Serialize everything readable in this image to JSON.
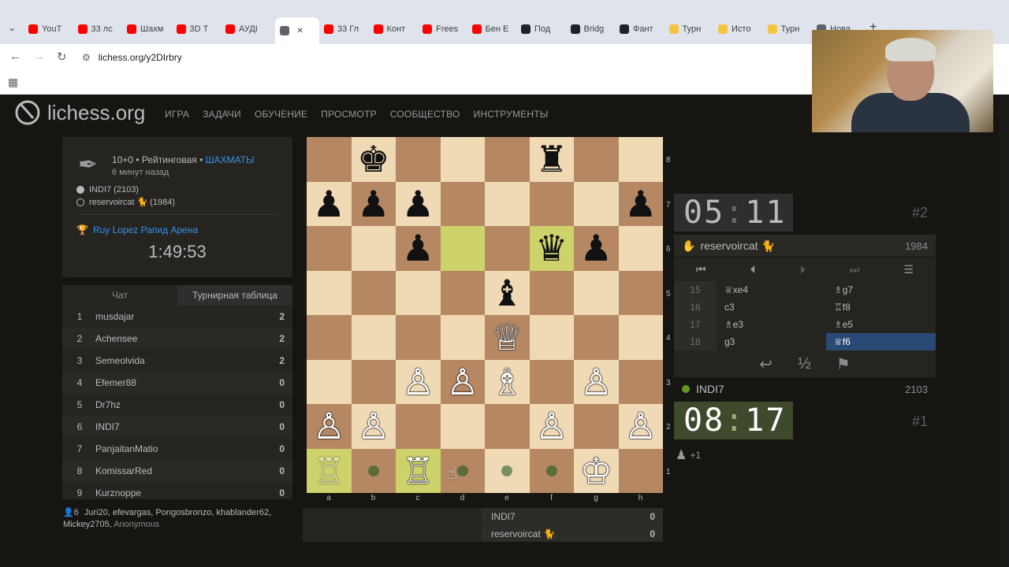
{
  "browser": {
    "tabs": [
      "YouT",
      "33 лс",
      "Шахм",
      "3D Т",
      "АУДІ",
      "",
      "33 Гл",
      "Конт",
      "Frees",
      "Бен Е",
      "Под",
      "Bridg",
      "Фант",
      "Турн",
      "Исто",
      "Турн",
      "Нова"
    ],
    "url": "lichess.org/y2DIrbry"
  },
  "site": {
    "logo": "lichess.org",
    "nav": [
      "ИГРА",
      "ЗАДАЧИ",
      "ОБУЧЕНИЕ",
      "ПРОСМОТР",
      "СООБЩЕСТВО",
      "ИНСТРУМЕНТЫ"
    ]
  },
  "game": {
    "mode": "10+0 • Рейтинговая •",
    "variant": "ШАХМАТЫ",
    "time_ago": "6 минут назад",
    "white_player": "INDI7 (2103)",
    "black_player": "reservoircat 🐈 (1984)",
    "tournament": "Ruy Lopez Рапид Арена",
    "tournament_clock": "1:49:53"
  },
  "standings": {
    "tabs": [
      "Чат",
      "Турнирная таблица"
    ],
    "rows": [
      {
        "rank": "1",
        "name": "musdajar",
        "score": "2"
      },
      {
        "rank": "2",
        "name": "Achensee",
        "score": "2"
      },
      {
        "rank": "3",
        "name": "Semeolvida",
        "score": "2"
      },
      {
        "rank": "4",
        "name": "Efemer88",
        "score": "0"
      },
      {
        "rank": "5",
        "name": "Dr7hz",
        "score": "0"
      },
      {
        "rank": "6",
        "name": "INDI7",
        "score": "0"
      },
      {
        "rank": "7",
        "name": "PanjaitanMatio",
        "score": "0"
      },
      {
        "rank": "8",
        "name": "KomissarRed",
        "score": "0"
      },
      {
        "rank": "9",
        "name": "Kurznoppe",
        "score": "0"
      }
    ]
  },
  "spectators": {
    "count": "6",
    "names": "Juri20, efevargas, Pongosbronzo, khablander62, Mickey2705,",
    "anon": "Anonymous"
  },
  "board": {
    "files": [
      "a",
      "b",
      "c",
      "d",
      "e",
      "f",
      "g",
      "h"
    ],
    "ranks": [
      "8",
      "7",
      "6",
      "5",
      "4",
      "3",
      "2",
      "1"
    ],
    "pieces": [
      {
        "sq": "b8",
        "glyph": "♚",
        "side": "b"
      },
      {
        "sq": "f8",
        "glyph": "♜",
        "side": "b"
      },
      {
        "sq": "a7",
        "glyph": "♟",
        "side": "b"
      },
      {
        "sq": "b7",
        "glyph": "♟",
        "side": "b"
      },
      {
        "sq": "c7",
        "glyph": "♟",
        "side": "b"
      },
      {
        "sq": "h7",
        "glyph": "♟",
        "side": "b"
      },
      {
        "sq": "c6",
        "glyph": "♟",
        "side": "b"
      },
      {
        "sq": "f6",
        "glyph": "♛",
        "side": "b"
      },
      {
        "sq": "g6",
        "glyph": "♟",
        "side": "b"
      },
      {
        "sq": "e5",
        "glyph": "♝",
        "side": "b"
      },
      {
        "sq": "e4",
        "glyph": "♕",
        "side": "w"
      },
      {
        "sq": "c3",
        "glyph": "♙",
        "side": "w"
      },
      {
        "sq": "d3",
        "glyph": "♙",
        "side": "w"
      },
      {
        "sq": "e3",
        "glyph": "♗",
        "side": "w"
      },
      {
        "sq": "g3",
        "glyph": "♙",
        "side": "w"
      },
      {
        "sq": "a2",
        "glyph": "♙",
        "side": "w"
      },
      {
        "sq": "b2",
        "glyph": "♙",
        "side": "w"
      },
      {
        "sq": "f2",
        "glyph": "♙",
        "side": "w"
      },
      {
        "sq": "h2",
        "glyph": "♙",
        "side": "w"
      },
      {
        "sq": "a1",
        "glyph": "♖",
        "side": "w",
        "faded": true
      },
      {
        "sq": "c1",
        "glyph": "♖",
        "side": "w"
      },
      {
        "sq": "g1",
        "glyph": "♔",
        "side": "w"
      }
    ],
    "highlights": [
      "d6",
      "f6",
      "a1",
      "c1"
    ],
    "move_dots": [
      "b1",
      "d1",
      "e1",
      "f1"
    ]
  },
  "score_table": [
    {
      "name": "INDI7",
      "score": "0"
    },
    {
      "name": "reservoircat 🐈",
      "score": "0"
    }
  ],
  "clocks": {
    "top_min": "05",
    "top_sec": "11",
    "top_rank": "#2",
    "bottom_min": "08",
    "bottom_sec": "17",
    "bottom_rank": "#1"
  },
  "players": {
    "top_name": "reservoircat 🐈",
    "top_rating": "1984",
    "bottom_name": "INDI7",
    "bottom_rating": "2103"
  },
  "moves": [
    {
      "n": "15",
      "w": "♕xe4",
      "b": "♗g7"
    },
    {
      "n": "16",
      "w": "c3",
      "b": "♖f8"
    },
    {
      "n": "17",
      "w": "♗e3",
      "b": "♗e5"
    },
    {
      "n": "18",
      "w": "g3",
      "b": "♕f6"
    }
  ],
  "material": "+1",
  "colors": {
    "light_sq": "#f0d9b5",
    "dark_sq": "#b58863",
    "highlight": "#aaa23a",
    "accent": "#3692e7"
  }
}
